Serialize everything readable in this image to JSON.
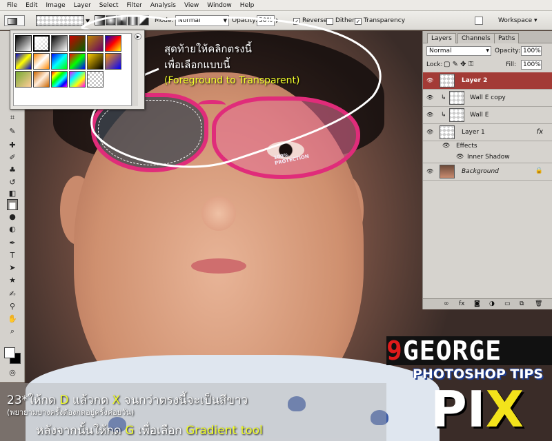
{
  "menu": [
    "File",
    "Edit",
    "Image",
    "Layer",
    "Select",
    "Filter",
    "Analysis",
    "View",
    "Window",
    "Help"
  ],
  "options": {
    "mode_label": "Mode:",
    "mode_value": "Normal",
    "opacity_label": "Opacity:",
    "opacity_value": "50%",
    "reverse_label": "Reverse",
    "dither_label": "Dither",
    "transparency_label": "Transparency",
    "workspace_label": "Workspace ▾"
  },
  "annotation": {
    "line1": "สุดท้ายให้คลิกตรงนี้",
    "line2": "เพื่อเลือกแบบนี้",
    "line3": "(Foreground to Transparent)"
  },
  "lens_text": "100%\nPROTECTION",
  "layers_panel": {
    "tabs": [
      "Layers",
      "Channels",
      "Paths"
    ],
    "blend_mode": "Normal",
    "opacity_label": "Opacity:",
    "opacity_value": "100%",
    "lock_label": "Lock:",
    "fill_label": "Fill:",
    "fill_value": "100%",
    "layers": [
      {
        "name": "Layer 2",
        "selected": true
      },
      {
        "name": "Wall E copy",
        "selected": false
      },
      {
        "name": "Wall E",
        "selected": false
      },
      {
        "name": "Layer 1",
        "selected": false
      },
      {
        "name": "Effects",
        "selected": false
      },
      {
        "name": "Inner Shadow",
        "selected": false
      },
      {
        "name": "Background",
        "selected": false
      }
    ]
  },
  "brand": {
    "george_9": "9",
    "george": "GEORGE",
    "tips": "PHOTOSHOP TIPS",
    "pi": "PI",
    "x": "X"
  },
  "caption": {
    "line1_a": "23*ให้กด ",
    "line1_d": "D",
    "line1_b": " แล้วกด ",
    "line1_x": "X",
    "line1_c": " จนกว่าตรงนี้จะเป็นสีขาว",
    "line2": "(พยายามบางครั้งต้องกดอยู่ครั้งค่อยวัน)",
    "line3_a": "หลังจากนั้นให้กด ",
    "line3_g": "G",
    "line3_b": " เพื่อเลือก ",
    "line3_tool": "Gradient tool"
  }
}
